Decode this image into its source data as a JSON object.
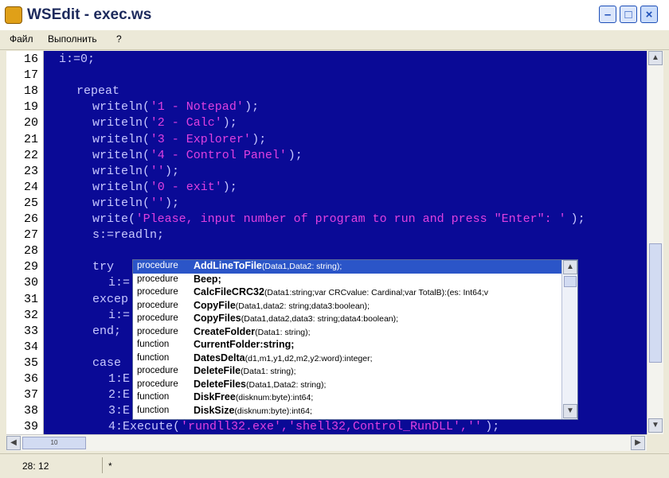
{
  "window": {
    "title": "WSEdit - exec.ws"
  },
  "menu": [
    "Файл",
    "Выполнить",
    "?"
  ],
  "editor": {
    "lines": [
      {
        "n": "16",
        "indent": 1,
        "parts": [
          {
            "t": "i:=0;",
            "c": "kw"
          }
        ]
      },
      {
        "n": "17",
        "indent": 0,
        "parts": []
      },
      {
        "n": "18",
        "indent": 2,
        "parts": [
          {
            "t": "repeat",
            "c": "kw"
          }
        ]
      },
      {
        "n": "19",
        "indent": 3,
        "parts": [
          {
            "t": "writeln(",
            "c": "kw"
          },
          {
            "t": "'1 - Notepad'",
            "c": "str"
          },
          {
            "t": ");",
            "c": "kw"
          }
        ]
      },
      {
        "n": "20",
        "indent": 3,
        "parts": [
          {
            "t": "writeln(",
            "c": "kw"
          },
          {
            "t": "'2 - Calc'",
            "c": "str"
          },
          {
            "t": ");",
            "c": "kw"
          }
        ]
      },
      {
        "n": "21",
        "indent": 3,
        "parts": [
          {
            "t": "writeln(",
            "c": "kw"
          },
          {
            "t": "'3 - Explorer'",
            "c": "str"
          },
          {
            "t": ");",
            "c": "kw"
          }
        ]
      },
      {
        "n": "22",
        "indent": 3,
        "parts": [
          {
            "t": "writeln(",
            "c": "kw"
          },
          {
            "t": "'4 - Control Panel'",
            "c": "str"
          },
          {
            "t": ");",
            "c": "kw"
          }
        ]
      },
      {
        "n": "23",
        "indent": 3,
        "parts": [
          {
            "t": "writeln(",
            "c": "kw"
          },
          {
            "t": "''",
            "c": "str"
          },
          {
            "t": ");",
            "c": "kw"
          }
        ]
      },
      {
        "n": "24",
        "indent": 3,
        "parts": [
          {
            "t": "writeln(",
            "c": "kw"
          },
          {
            "t": "'0 - exit'",
            "c": "str"
          },
          {
            "t": ");",
            "c": "kw"
          }
        ]
      },
      {
        "n": "25",
        "indent": 3,
        "parts": [
          {
            "t": "writeln(",
            "c": "kw"
          },
          {
            "t": "''",
            "c": "str"
          },
          {
            "t": ");",
            "c": "kw"
          }
        ]
      },
      {
        "n": "26",
        "indent": 3,
        "parts": [
          {
            "t": "write(",
            "c": "kw"
          },
          {
            "t": "'Please, input number of program to run and press \"Enter\": '",
            "c": "str"
          },
          {
            "t": ");",
            "c": "kw"
          }
        ]
      },
      {
        "n": "27",
        "indent": 3,
        "parts": [
          {
            "t": "s:=readln;",
            "c": "kw"
          }
        ]
      },
      {
        "n": "28",
        "indent": 0,
        "parts": []
      },
      {
        "n": "29",
        "indent": 3,
        "parts": [
          {
            "t": "try",
            "c": "kw"
          }
        ]
      },
      {
        "n": "30",
        "indent": 4,
        "parts": [
          {
            "t": "i:=",
            "c": "kw"
          }
        ]
      },
      {
        "n": "31",
        "indent": 3,
        "parts": [
          {
            "t": "excep",
            "c": "kw"
          }
        ]
      },
      {
        "n": "32",
        "indent": 4,
        "parts": [
          {
            "t": "i:=",
            "c": "kw"
          }
        ]
      },
      {
        "n": "33",
        "indent": 3,
        "parts": [
          {
            "t": "end;",
            "c": "kw"
          }
        ]
      },
      {
        "n": "34",
        "indent": 0,
        "parts": []
      },
      {
        "n": "35",
        "indent": 3,
        "parts": [
          {
            "t": "case",
            "c": "kw"
          }
        ]
      },
      {
        "n": "36",
        "indent": 4,
        "parts": [
          {
            "t": "1:E",
            "c": "kw"
          }
        ]
      },
      {
        "n": "37",
        "indent": 4,
        "parts": [
          {
            "t": "2:E",
            "c": "kw"
          }
        ]
      },
      {
        "n": "38",
        "indent": 4,
        "parts": [
          {
            "t": "3:E",
            "c": "kw"
          }
        ]
      },
      {
        "n": "39",
        "indent": 4,
        "parts": [
          {
            "t": "4:Execute(",
            "c": "kw"
          },
          {
            "t": "'rundll32.exe','shell32,Control_RunDLL',''",
            "c": "str"
          },
          {
            "t": ");",
            "c": "kw"
          }
        ]
      }
    ]
  },
  "hscroll_label": "10",
  "autocomplete": [
    {
      "kind": "procedure",
      "name": "AddLineToFile",
      "sig": "(Data1,Data2: string);"
    },
    {
      "kind": "procedure",
      "name": "Beep;",
      "sig": ""
    },
    {
      "kind": "procedure",
      "name": "CalcFileCRC32",
      "sig": "(Data1:string;var CRCvalue: Cardinal;var TotalB):(es: Int64;v"
    },
    {
      "kind": "procedure",
      "name": "CopyFile",
      "sig": "(Data1,data2: string;data3:boolean);"
    },
    {
      "kind": "procedure",
      "name": "CopyFiles",
      "sig": "(Data1,data2,data3: string;data4:boolean);"
    },
    {
      "kind": "procedure",
      "name": "CreateFolder",
      "sig": "(Data1: string);"
    },
    {
      "kind": "function",
      "name": "CurrentFolder:string;",
      "sig": ""
    },
    {
      "kind": "function",
      "name": "DatesDelta",
      "sig": "(d1,m1,y1,d2,m2,y2:word):integer;"
    },
    {
      "kind": "procedure",
      "name": "DeleteFile",
      "sig": "(Data1: string);"
    },
    {
      "kind": "procedure",
      "name": "DeleteFiles",
      "sig": "(Data1,Data2: string);"
    },
    {
      "kind": "function",
      "name": "DiskFree",
      "sig": "(disknum:byte):int64;"
    },
    {
      "kind": "function",
      "name": "DiskSize",
      "sig": "(disknum:byte):int64;"
    }
  ],
  "status": {
    "position": "28: 12",
    "modified": "*"
  },
  "colors": {
    "editor_bg": "#0a0a96",
    "keyword": "#c8c8ff",
    "string": "#e040e0",
    "selection": "#2b55c8"
  }
}
